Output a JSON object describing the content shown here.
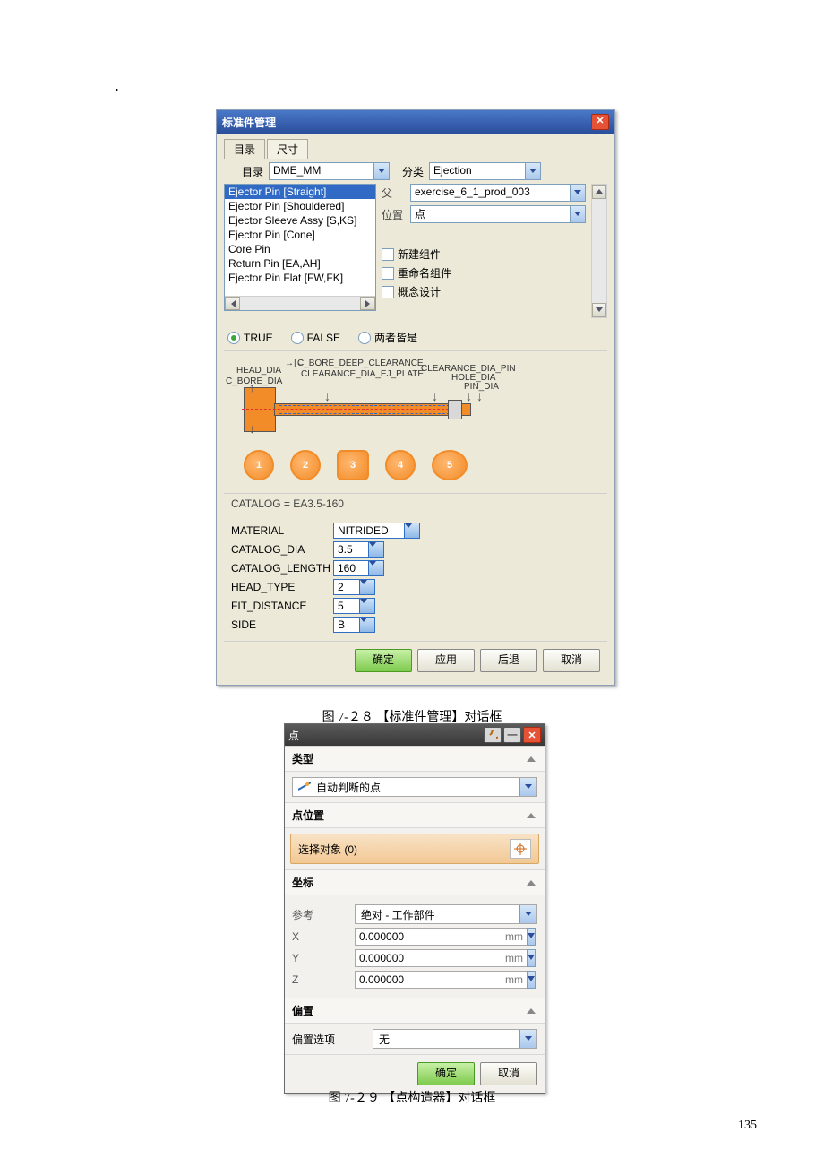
{
  "page_number": "135",
  "caption1": "图 7-２８ 【标准件管理】对话框",
  "caption2": "图 7-２９ 【点构造器】对话框",
  "dlg1": {
    "title": "标准件管理",
    "tabs": [
      "目录",
      "尺寸"
    ],
    "catalog_label": "目录",
    "catalog_value": "DME_MM",
    "class_label": "分类",
    "class_value": "Ejection",
    "list": [
      "Ejector Pin [Straight]",
      "Ejector Pin [Shouldered]",
      "Ejector Sleeve Assy [S,KS]",
      "Ejector Pin [Cone]",
      "Core Pin",
      "Return Pin [EA,AH]",
      "Ejector Pin Flat [FW,FK]"
    ],
    "list_selected": 0,
    "parent_label": "父",
    "parent_value": "exercise_6_1_prod_003",
    "pos_label": "位置",
    "pos_value": "点",
    "chk_new": "新建组件",
    "chk_rename": "重命名组件",
    "chk_concept": "概念设计",
    "radio_true": "TRUE",
    "radio_false": "FALSE",
    "radio_both": "两者皆是",
    "dia_labels": {
      "head_dia": "HEAD_DIA",
      "c_bore_dia": "C_BORE_DIA",
      "c_bore_deep": "C_BORE_DEEP_CLEARANCE",
      "clr_ej": "CLEARANCE_DIA_EJ_PLATE",
      "clr_pin": "CLEARANCE_DIA_PIN",
      "hole": "HOLE_DIA",
      "pin": "PIN_DIA"
    },
    "thumb_labels": [
      "1",
      "2",
      "3",
      "4",
      "5"
    ],
    "catalog_line": "CATALOG = EA3.5-160",
    "params": [
      {
        "label": "MATERIAL",
        "value": "NITRIDED",
        "w": 70
      },
      {
        "label": "CATALOG_DIA",
        "value": "3.5",
        "w": 30
      },
      {
        "label": "CATALOG_LENGTH",
        "value": "160",
        "w": 30
      },
      {
        "label": "HEAD_TYPE",
        "value": "2",
        "w": 20
      },
      {
        "label": "FIT_DISTANCE",
        "value": "5",
        "w": 20
      },
      {
        "label": "SIDE",
        "value": "B",
        "w": 20
      }
    ],
    "btn_ok": "确定",
    "btn_apply": "应用",
    "btn_back": "后退",
    "btn_cancel": "取消"
  },
  "dlg2": {
    "title": "点",
    "sect_type": "类型",
    "type_value": "自动判断的点",
    "sect_pos": "点位置",
    "selobj": "选择对象 (0)",
    "sect_coord": "坐标",
    "ref_label": "参考",
    "ref_value": "绝对 - 工作部件",
    "x_label": "X",
    "x_value": "0.000000",
    "x_unit": "mm",
    "y_label": "Y",
    "y_value": "0.000000",
    "y_unit": "mm",
    "z_label": "Z",
    "z_value": "0.000000",
    "z_unit": "mm",
    "sect_offset": "偏置",
    "offset_label": "偏置选项",
    "offset_value": "无",
    "btn_ok": "确定",
    "btn_cancel": "取消"
  }
}
